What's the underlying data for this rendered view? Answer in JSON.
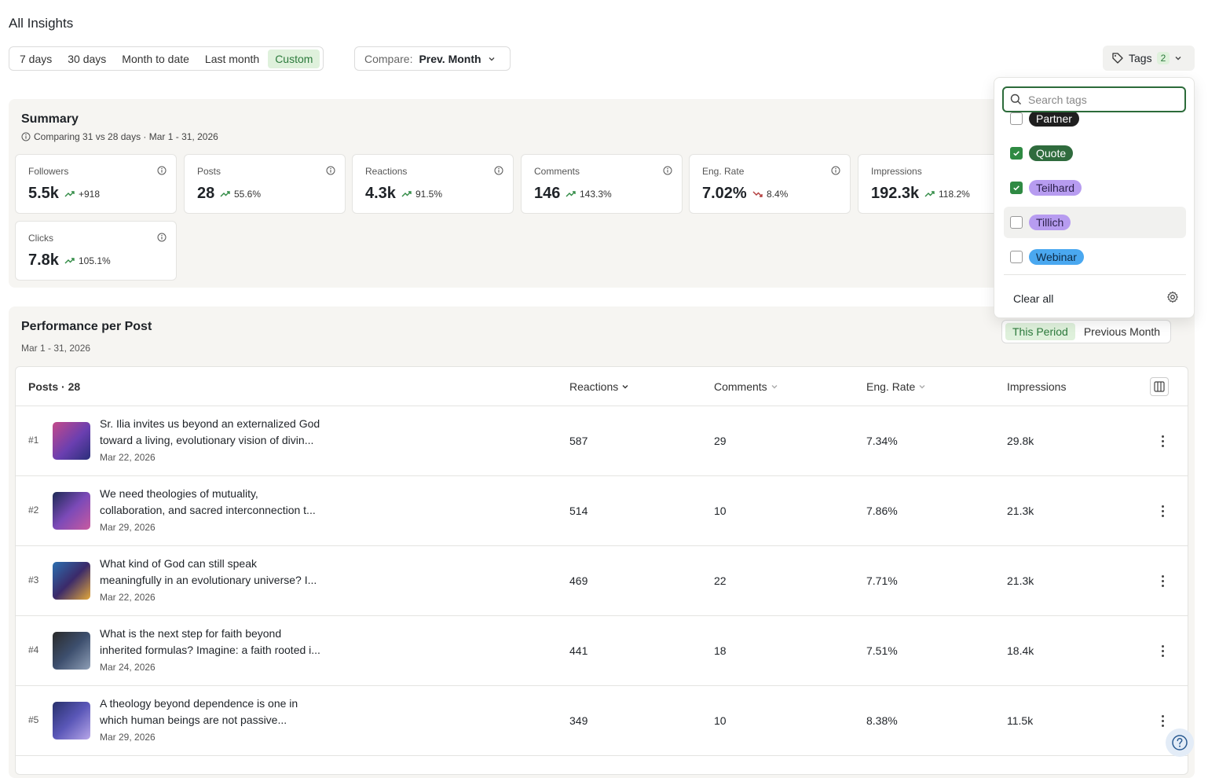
{
  "page": {
    "title": "All Insights"
  },
  "date_range": {
    "options": [
      "7 days",
      "30 days",
      "Month to date",
      "Last month",
      "Custom"
    ],
    "active": "Custom"
  },
  "compare": {
    "label": "Compare:",
    "value": "Prev. Month"
  },
  "tags_button": {
    "label": "Tags",
    "count": "2"
  },
  "summary": {
    "title": "Summary",
    "subtitle": "Comparing 31 vs 28 days · Mar 1 - 31, 2026",
    "metrics": [
      {
        "label": "Followers",
        "value": "5.5k",
        "delta": "+918",
        "trend": "up"
      },
      {
        "label": "Posts",
        "value": "28",
        "delta": "55.6%",
        "trend": "up"
      },
      {
        "label": "Reactions",
        "value": "4.3k",
        "delta": "91.5%",
        "trend": "up"
      },
      {
        "label": "Comments",
        "value": "146",
        "delta": "143.3%",
        "trend": "up"
      },
      {
        "label": "Eng. Rate",
        "value": "7.02%",
        "delta": "8.4%",
        "trend": "down"
      },
      {
        "label": "Impressions",
        "value": "192.3k",
        "delta": "118.2%",
        "trend": "up"
      },
      {
        "label": "Clicks",
        "value": "7.8k",
        "delta": "105.1%",
        "trend": "up"
      }
    ]
  },
  "performance": {
    "title": "Performance per Post",
    "subtitle": "Mar 1 - 31, 2026",
    "toggle": {
      "this_period": "This Period",
      "previous": "Previous Month",
      "active": "This Period"
    },
    "columns": {
      "posts": "Posts · 28",
      "reactions": "Reactions",
      "comments": "Comments",
      "eng_rate": "Eng. Rate",
      "impressions": "Impressions"
    },
    "rows": [
      {
        "rank": "#1",
        "line1": "Sr. Ilia invites us beyond an externalized God",
        "line2": "toward a living, evolutionary vision of divin...",
        "date": "Mar 22, 2026",
        "reactions": "587",
        "comments": "29",
        "eng_rate": "7.34%",
        "impressions": "29.8k"
      },
      {
        "rank": "#2",
        "line1": "We need theologies of mutuality,",
        "line2": "collaboration, and sacred interconnection t...",
        "date": "Mar 29, 2026",
        "reactions": "514",
        "comments": "10",
        "eng_rate": "7.86%",
        "impressions": "21.3k"
      },
      {
        "rank": "#3",
        "line1": "What kind of God can still speak",
        "line2": "meaningfully in an evolutionary universe? I...",
        "date": "Mar 22, 2026",
        "reactions": "469",
        "comments": "22",
        "eng_rate": "7.71%",
        "impressions": "21.3k"
      },
      {
        "rank": "#4",
        "line1": "What is the next step for faith beyond",
        "line2": "inherited formulas? Imagine: a faith rooted i...",
        "date": "Mar 24, 2026",
        "reactions": "441",
        "comments": "18",
        "eng_rate": "7.51%",
        "impressions": "18.4k"
      },
      {
        "rank": "#5",
        "line1": "A theology beyond dependence is one in",
        "line2": "which human beings are not passive...",
        "date": "Mar 29, 2026",
        "reactions": "349",
        "comments": "10",
        "eng_rate": "8.38%",
        "impressions": "11.5k"
      }
    ]
  },
  "tags_dropdown": {
    "search_placeholder": "Search tags",
    "tags": [
      {
        "name": "Partner",
        "checked": false,
        "color": "#1f1f1f",
        "text_color": "#ffffff"
      },
      {
        "name": "Quote",
        "checked": true,
        "color": "#2f6b3d",
        "text_color": "#ffffff"
      },
      {
        "name": "Teilhard",
        "checked": true,
        "color": "#b79cf0",
        "text_color": "#2a1f4a"
      },
      {
        "name": "Tillich",
        "checked": false,
        "color": "#b79cf0",
        "text_color": "#2a1f4a"
      },
      {
        "name": "Webinar",
        "checked": false,
        "color": "#4aa8f0",
        "text_color": "#0d2a45"
      }
    ],
    "clear_all": "Clear all"
  },
  "colors": {
    "accent_green": "#2c7a3c",
    "trend_up": "#2f8a43",
    "trend_down": "#b23a3a"
  }
}
